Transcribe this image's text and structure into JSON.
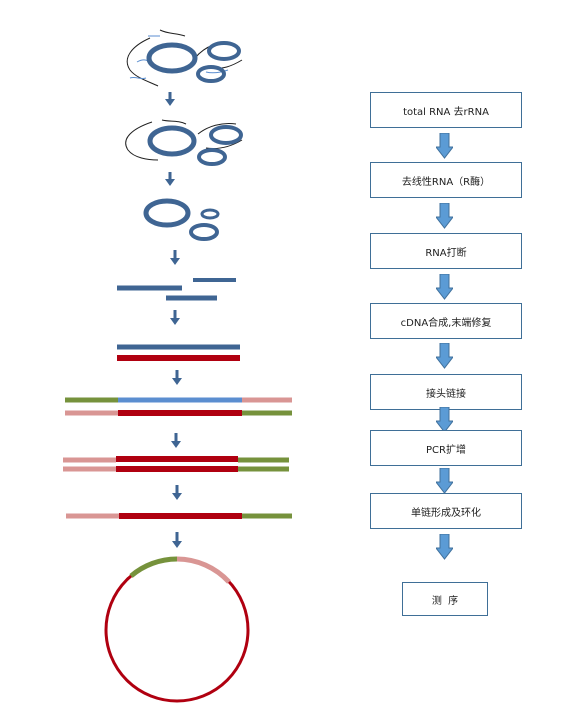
{
  "workflow": {
    "steps": [
      {
        "label": "total RNA 去rRNA"
      },
      {
        "label": "去线性RNA（R酶）"
      },
      {
        "label": "RNA打断"
      },
      {
        "label": "cDNA合成,末端修复"
      },
      {
        "label": "接头链接"
      },
      {
        "label": "PCR扩增"
      },
      {
        "label": "单链形成及环化"
      },
      {
        "label": "测  序"
      }
    ]
  },
  "colors": {
    "rna_blue": "#3f6593",
    "light_blue": "#5b8ed0",
    "dna_red": "#b00010",
    "adapter_green": "#76923c",
    "adapter_pink": "#d99694",
    "box_border": "#3f6f97",
    "arrow_fill": "#5b9bd5",
    "arrow_stroke": "#41719c"
  }
}
